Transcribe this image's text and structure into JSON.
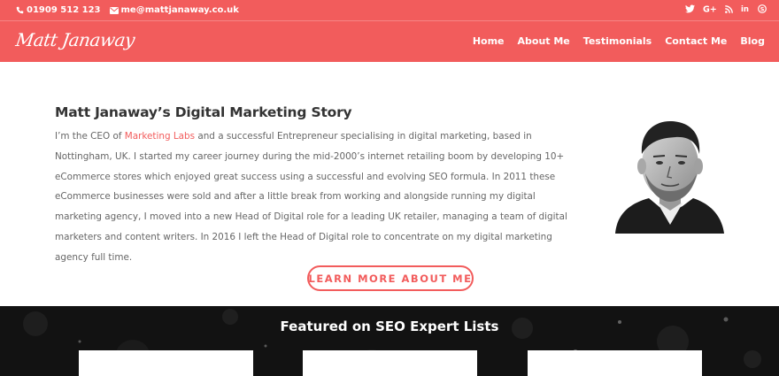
{
  "topbar": {
    "phone": "01909 512 123",
    "email": "me@mattjanaway.co.uk",
    "social_icons": [
      "twitter-icon",
      "google-plus-icon",
      "rss-icon",
      "linkedin-icon",
      "skype-icon"
    ]
  },
  "nav": {
    "logo": "Matt Janaway",
    "items": [
      "Home",
      "About Me",
      "Testimonials",
      "Contact Me",
      "Blog"
    ]
  },
  "story": {
    "title": "Matt Janaway’s Digital Marketing Story",
    "line1_prefix": "I’m the CEO of ",
    "line1_link": "Marketing Labs",
    "line1_suffix": " and a successful Entrepreneur specialising in digital marketing, based in",
    "line2": "Nottingham, UK. I started my career journey during the mid-2000’s internet retailing boom by developing 10+",
    "line3": "eCommerce stores which enjoyed great success using a successful and evolving SEO formula. In 2011 these",
    "line4": "eCommerce businesses were sold and after a little break from working and alongside running my digital",
    "line5": "marketing agency, I moved into a new Head of Digital role for a leading UK retailer, managing a team of digital",
    "line6": "marketers and content writers. In 2016 I left the Head of Digital role to concentrate on my digital marketing",
    "line7": "agency full time.",
    "cta": "LEARN MORE ABOUT ME"
  },
  "featured": {
    "heading": "Featured on SEO Expert Lists"
  },
  "colors": {
    "brand": "#f25c5c",
    "dark_section": "#121212",
    "body_text": "#666666",
    "heading_text": "#333333"
  }
}
